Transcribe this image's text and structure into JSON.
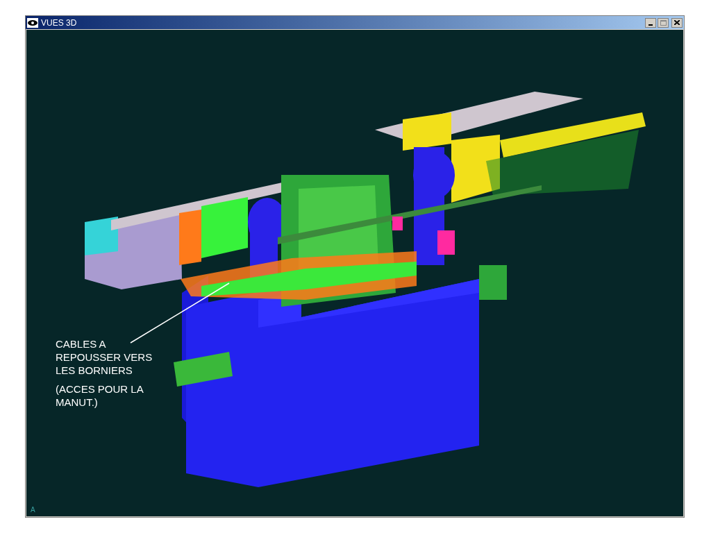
{
  "window": {
    "title": "VUES 3D"
  },
  "viewport": {
    "annotation": {
      "lines": [
        "CABLES A",
        "REPOUSSER VERS",
        "LES BORNIERS"
      ],
      "note_lines": [
        "(ACCES POUR LA",
        "MANUT.)"
      ]
    },
    "axis_label": "A"
  }
}
